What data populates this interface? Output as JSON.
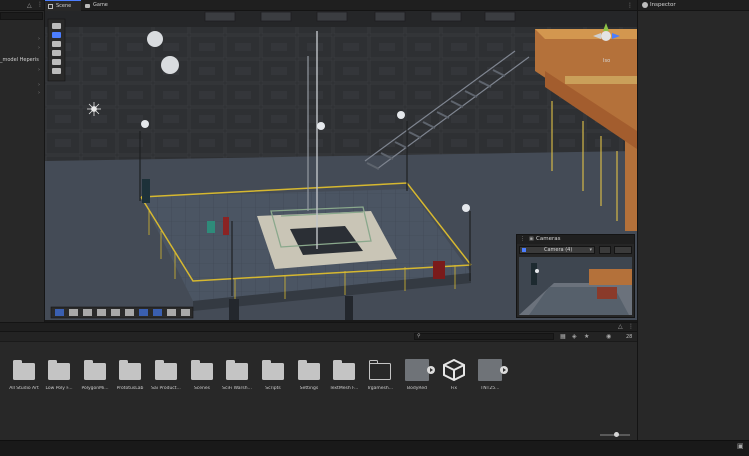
{
  "hierarchy": {
    "item_label": "_model Heperis",
    "add_icon": "plus-icon",
    "menu_icon": "kebab-icon",
    "lock_icon": "lock-icon"
  },
  "scene_tabs": [
    {
      "label": "Scene",
      "icon": "hash-icon",
      "active": true
    },
    {
      "label": "Game",
      "icon": "gamepad-icon",
      "active": false
    }
  ],
  "scene": {
    "gizmo_axis_label": "Iso",
    "cameras_overlay": {
      "title": "Cameras",
      "selected": "Camera (4)"
    }
  },
  "inspector": {
    "title": "Inspector",
    "icon": "info-icon"
  },
  "project": {
    "visibility_count": "28",
    "assets": [
      {
        "label": "All Studio Art",
        "kind": "folder"
      },
      {
        "label": "Low Poly F...",
        "kind": "folder"
      },
      {
        "label": "PolygonMi...",
        "kind": "folder"
      },
      {
        "label": "PrototusLab",
        "kind": "folder"
      },
      {
        "label": "Sai Product...",
        "kind": "folder"
      },
      {
        "label": "Scenes",
        "kind": "folder"
      },
      {
        "label": "SciFi Warsh...",
        "kind": "folder"
      },
      {
        "label": "Scripts",
        "kind": "folder"
      },
      {
        "label": "Settings",
        "kind": "folder"
      },
      {
        "label": "TextMesh F...",
        "kind": "folder"
      },
      {
        "label": "Trgamesh...",
        "kind": "folder-empty"
      },
      {
        "label": "BodyRed",
        "kind": "prefab"
      },
      {
        "label": "Fix",
        "kind": "unity"
      },
      {
        "label": "TNT25...",
        "kind": "prefab"
      }
    ]
  },
  "colors": {
    "accent": "#4c7eff",
    "panel": "#282828",
    "toolbar": "#1f1f1f",
    "highlight_yellow": "#d6b830"
  }
}
